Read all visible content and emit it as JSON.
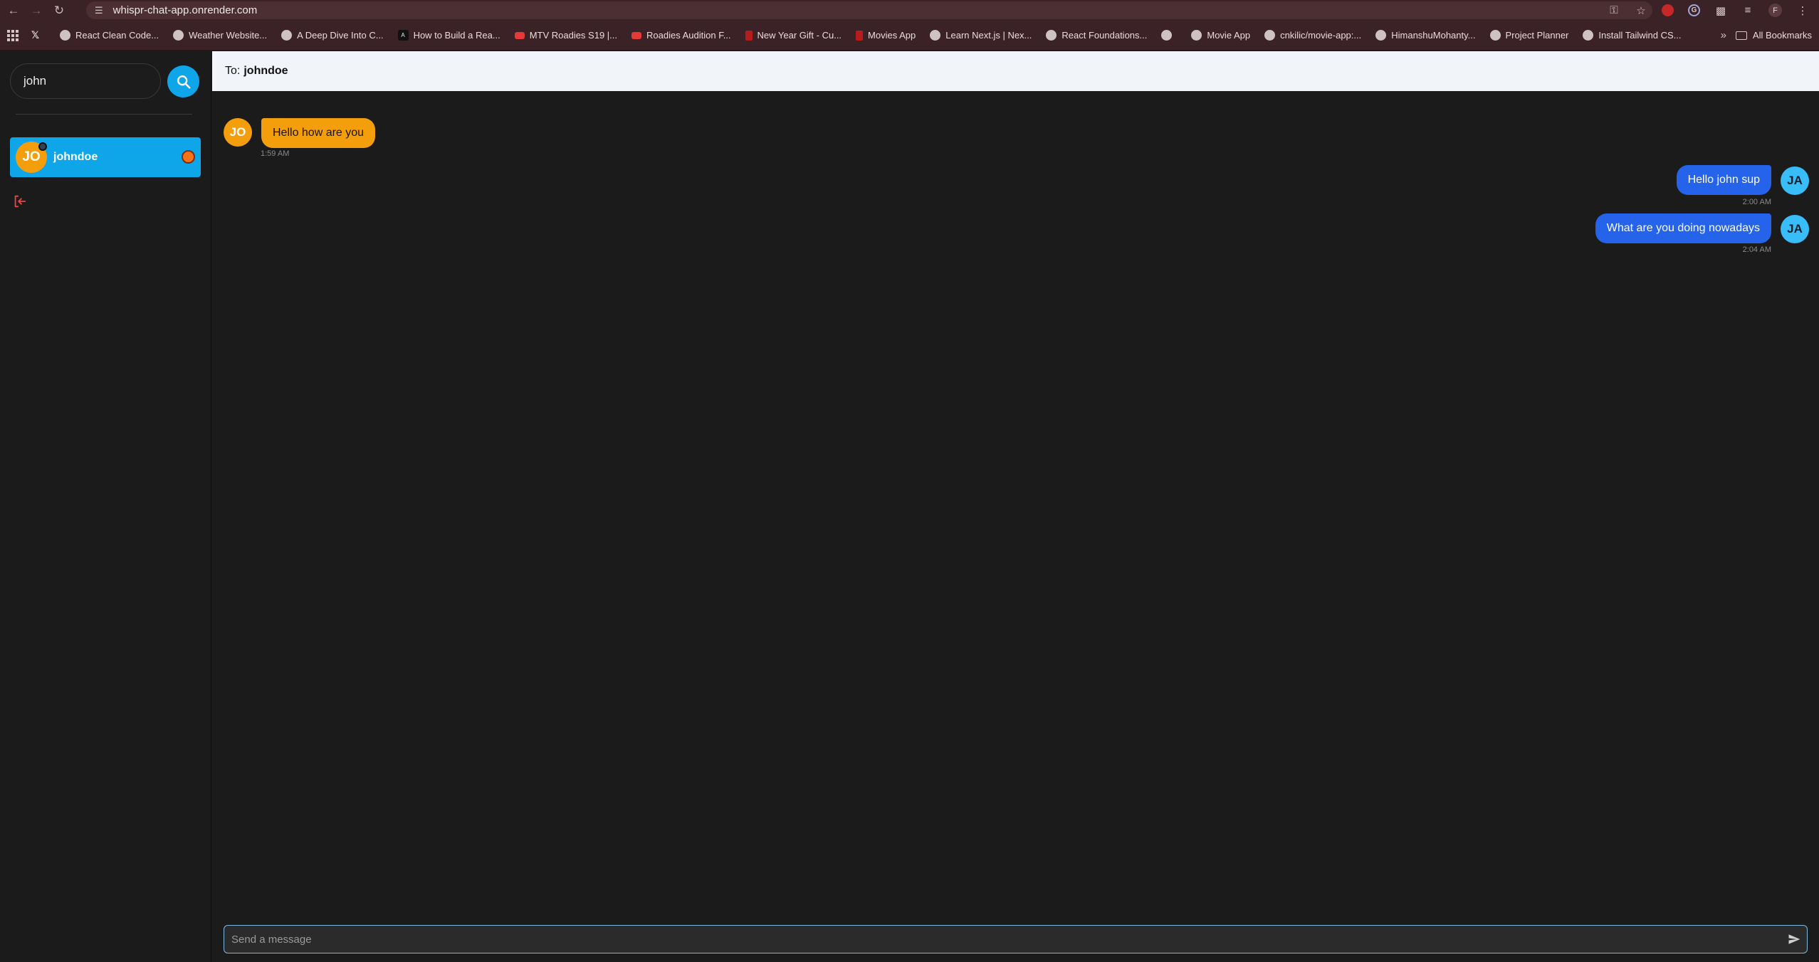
{
  "browser": {
    "url": "whispr-chat-app.onrender.com",
    "profile_initial": "F",
    "bookmarks": [
      {
        "label": "",
        "icon": "x-logo"
      },
      {
        "label": "React Clean Code...",
        "icon": "globe"
      },
      {
        "label": "Weather Website...",
        "icon": "globe"
      },
      {
        "label": "A Deep Dive Into C...",
        "icon": "globe"
      },
      {
        "label": "How to Build a Rea...",
        "icon": "a-logo"
      },
      {
        "label": "MTV Roadies S19 |...",
        "icon": "youtube"
      },
      {
        "label": "Roadies Audition F...",
        "icon": "youtube"
      },
      {
        "label": "New Year Gift - Cu...",
        "icon": "red-doc"
      },
      {
        "label": "Movies App",
        "icon": "red-doc"
      },
      {
        "label": "Learn Next.js | Nex...",
        "icon": "globe"
      },
      {
        "label": "React Foundations...",
        "icon": "globe"
      },
      {
        "label": "",
        "icon": "globe"
      },
      {
        "label": "Movie App",
        "icon": "globe"
      },
      {
        "label": "cnkilic/movie-app:...",
        "icon": "globe"
      },
      {
        "label": "HimanshuMohanty...",
        "icon": "globe"
      },
      {
        "label": "Project Planner",
        "icon": "globe"
      },
      {
        "label": "Install Tailwind CS...",
        "icon": "globe"
      }
    ],
    "more_label": "»",
    "all_bookmarks": "All Bookmarks"
  },
  "sidebar": {
    "search_value": "john",
    "contact": {
      "initials": "JO",
      "name": "johndoe"
    }
  },
  "chat": {
    "to_label": "To:",
    "to_name": "johndoe",
    "messages": [
      {
        "direction": "in",
        "initials": "JO",
        "text": "Hello how are you",
        "time": "1:59 AM"
      },
      {
        "direction": "out",
        "initials": "JA",
        "text": "Hello john sup",
        "time": "2:00 AM"
      },
      {
        "direction": "out",
        "initials": "JA",
        "text": "What are you doing nowadays",
        "time": "2:04 AM"
      }
    ],
    "composer_placeholder": "Send a message"
  },
  "colors": {
    "accent": "#0ea5e9",
    "incoming_bubble": "#f59e0b",
    "outgoing_bubble": "#2563eb",
    "outgoing_avatar": "#38bdf8"
  }
}
